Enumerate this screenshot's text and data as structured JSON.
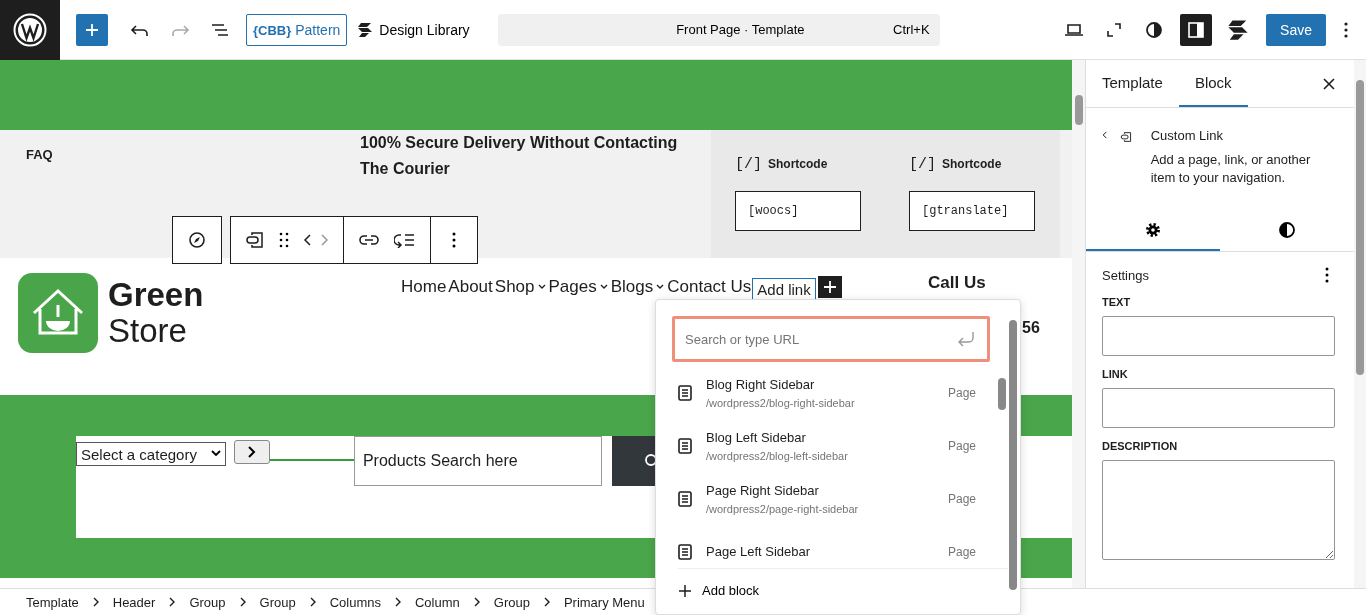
{
  "topbar": {
    "cbb_label": "{CBB}",
    "pattern": "Pattern",
    "design_library": "Design Library",
    "command": {
      "title": "Front Page · Template",
      "shortcut": "Ctrl+K"
    },
    "sidebar_toggle_on": true,
    "save": "Save"
  },
  "canvas": {
    "faq": "FAQ",
    "delivery": "100% Secure Delivery Without Contacting The Courier",
    "shortcodes": [
      {
        "mark": "[/]",
        "label": "Shortcode",
        "value": "[woocs]"
      },
      {
        "mark": "[/]",
        "label": "Shortcode",
        "value": "[gtranslate]"
      }
    ],
    "logo": {
      "line1": "Green",
      "line2": "Store"
    },
    "nav": [
      {
        "label": "Home",
        "submenu": false,
        "selected": false
      },
      {
        "label": "About",
        "submenu": false,
        "selected": false
      },
      {
        "label": "Shop",
        "submenu": true,
        "selected": false
      },
      {
        "label": "Pages",
        "submenu": true,
        "selected": false
      },
      {
        "label": "Blogs",
        "submenu": true,
        "selected": false
      },
      {
        "label": "Contact Us",
        "submenu": false,
        "selected": false
      },
      {
        "label": "Add link",
        "submenu": false,
        "selected": true
      }
    ],
    "call_us": "Call Us",
    "phone_fragment": "56",
    "category_select": "Select a category",
    "search_value": "Products Search here"
  },
  "link_popover": {
    "placeholder": "Search or type URL",
    "results": [
      {
        "title": "Blog Right Sidebar",
        "url": "/wordpress2/blog-right-sidebar",
        "type": "Page"
      },
      {
        "title": "Blog Left Sidebar",
        "url": "/wordpress2/blog-left-sidebar",
        "type": "Page"
      },
      {
        "title": "Page Right Sidebar",
        "url": "/wordpress2/page-right-sidebar",
        "type": "Page"
      },
      {
        "title": "Page Left Sidebar",
        "type": "Page"
      }
    ],
    "add_block": "Add block"
  },
  "breadcrumb": [
    "Template",
    "Header",
    "Group",
    "Group",
    "Columns",
    "Column",
    "Group",
    "Primary Menu"
  ],
  "sidebar": {
    "tabs": [
      {
        "label": "Template",
        "selected": false
      },
      {
        "label": "Block",
        "selected": true
      }
    ],
    "block": {
      "title": "Custom Link",
      "description": "Add a page, link, or another item to your navigation."
    },
    "inspector_tabs": [
      {
        "kind": "settings",
        "selected": true
      },
      {
        "kind": "styles",
        "selected": false
      }
    ],
    "panel_title": "Settings",
    "fields": [
      {
        "label": "TEXT",
        "kind": "input"
      },
      {
        "label": "LINK",
        "kind": "input"
      },
      {
        "label": "DESCRIPTION",
        "kind": "textarea"
      }
    ]
  }
}
